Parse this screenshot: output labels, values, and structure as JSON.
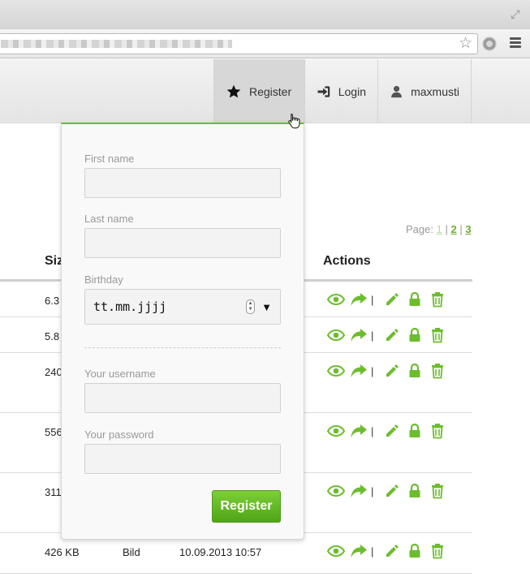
{
  "browser": {
    "bookmark_star_icon": "star-outline-icon",
    "menu_icon": "hamburger-icon",
    "expand_icon": "fullscreen-icon"
  },
  "nav": {
    "register_label": "Register",
    "login_label": "Login",
    "user_label": "maxmusti",
    "accent": "#6cbd2d"
  },
  "pager": {
    "label": "Page:",
    "pages": [
      "1",
      "2",
      "3"
    ],
    "separator": "|",
    "current": "1"
  },
  "table": {
    "headers": {
      "size": "Siz",
      "actions": "Actions"
    },
    "rows": [
      {
        "size": "6.3",
        "type": "",
        "date": ""
      },
      {
        "size": "5.8",
        "type": "",
        "date": ""
      },
      {
        "size": "240",
        "type": "",
        "date": ""
      },
      {
        "size": "556",
        "type": "",
        "date": ""
      },
      {
        "size": "311",
        "type": "",
        "date": ""
      },
      {
        "size": "426 KB",
        "type": "Bild",
        "date": "10.09.2013 10:57"
      }
    ],
    "action_icons": [
      "eye-icon",
      "share-arrow-icon",
      "pencil-icon",
      "lock-icon",
      "trash-icon"
    ],
    "action_separator": "|",
    "icon_color": "#6cbd2d"
  },
  "register_form": {
    "first_name_label": "First name",
    "last_name_label": "Last name",
    "birthday_label": "Birthday",
    "birthday_placeholder": "tt.mm.jjjj",
    "username_label": "Your username",
    "password_label": "Your password",
    "submit_label": "Register"
  }
}
